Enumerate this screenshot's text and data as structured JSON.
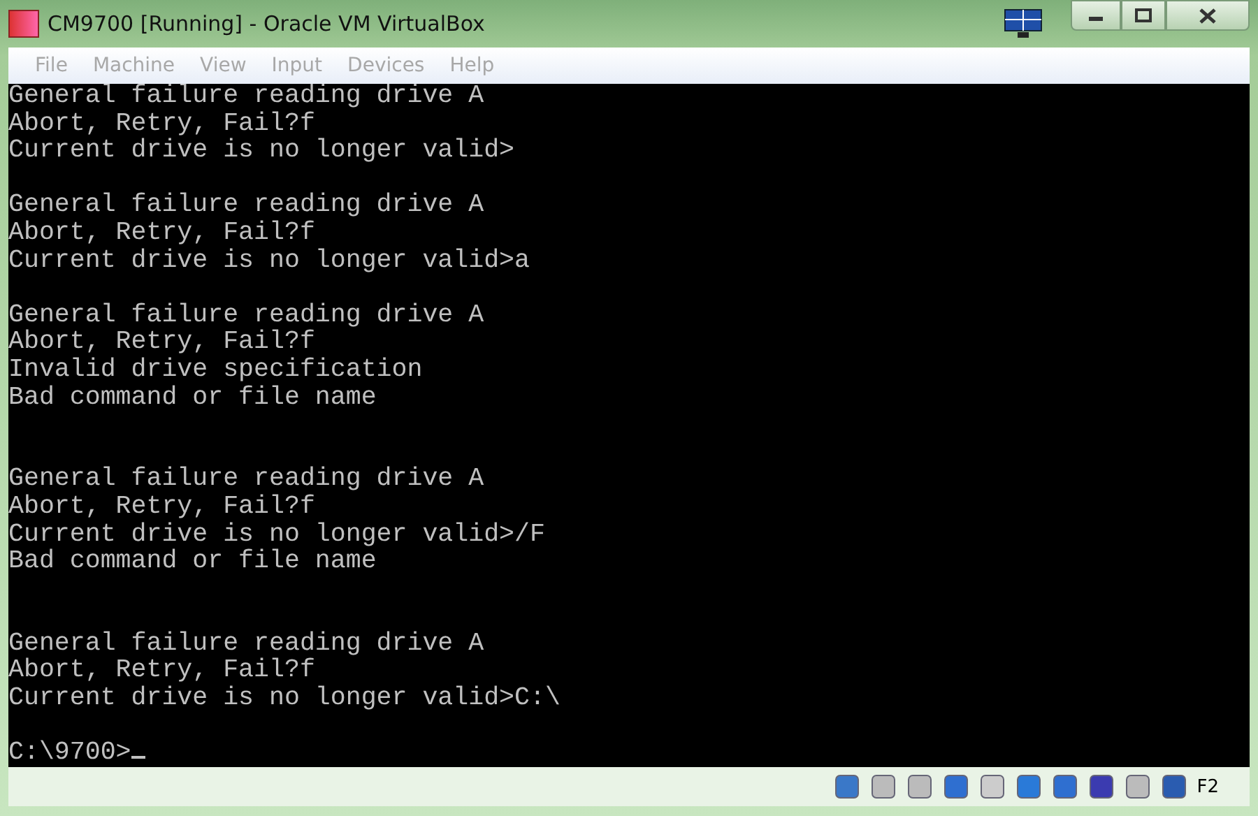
{
  "window": {
    "title": "CM9700 [Running] - Oracle VM VirtualBox"
  },
  "menu": [
    {
      "label": "File",
      "disabled": true
    },
    {
      "label": "Machine",
      "disabled": true
    },
    {
      "label": "View",
      "disabled": true
    },
    {
      "label": "Input",
      "disabled": true
    },
    {
      "label": "Devices",
      "disabled": true
    },
    {
      "label": "Help",
      "disabled": true
    }
  ],
  "console": {
    "text": "General failure reading drive A\nAbort, Retry, Fail?f\nCurrent drive is no longer valid>\n\nGeneral failure reading drive A\nAbort, Retry, Fail?f\nCurrent drive is no longer valid>a\n\nGeneral failure reading drive A\nAbort, Retry, Fail?f\nInvalid drive specification\nBad command or file name\n\n\nGeneral failure reading drive A\nAbort, Retry, Fail?f\nCurrent drive is no longer valid>/F\nBad command or file name\n\n\nGeneral failure reading drive A\nAbort, Retry, Fail?f\nCurrent drive is no longer valid>C:\\",
    "prompt": "C:\\9700>"
  },
  "status_bar": {
    "host_key": "F2"
  }
}
